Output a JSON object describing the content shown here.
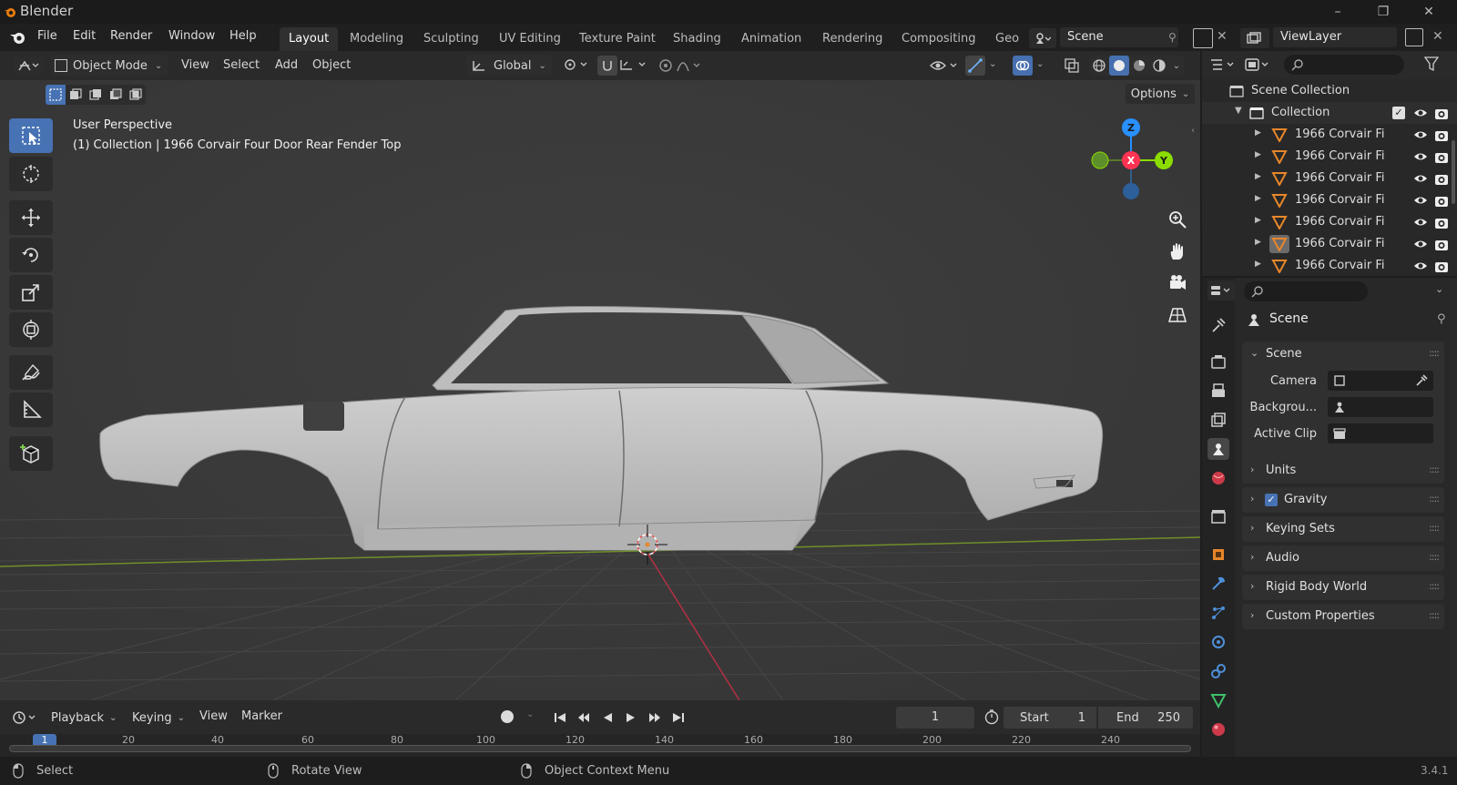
{
  "titlebar": {
    "app_title": "Blender"
  },
  "menu": {
    "file": "File",
    "edit": "Edit",
    "render": "Render",
    "window": "Window",
    "help": "Help"
  },
  "workspaces": [
    "Layout",
    "Modeling",
    "Sculpting",
    "UV Editing",
    "Texture Paint",
    "Shading",
    "Animation",
    "Rendering",
    "Compositing",
    "Geo"
  ],
  "scene_field": "Scene",
  "viewlayer_field": "ViewLayer",
  "viewport": {
    "mode": "Object Mode",
    "menus": {
      "view": "View",
      "select": "Select",
      "add": "Add",
      "object": "Object"
    },
    "transform_orientation": "Global",
    "options_label": "Options",
    "perspective_label": "User Perspective",
    "object_info": "(1) Collection | 1966 Corvair Four Door Rear Fender Top",
    "gizmo": {
      "x": "X",
      "y": "Y",
      "z": "Z"
    }
  },
  "outliner": {
    "scene_collection": "Scene Collection",
    "collection": "Collection",
    "items": [
      "1966 Corvair Fi",
      "1966 Corvair Fi",
      "1966 Corvair Fi",
      "1966 Corvair Fi",
      "1966 Corvair Fi",
      "1966 Corvair Fi",
      "1966 Corvair Fi"
    ]
  },
  "properties": {
    "header": "Scene",
    "scene_panel": "Scene",
    "camera_label": "Camera",
    "background_label": "Backgrou...",
    "active_clip_label": "Active Clip",
    "panels": [
      "Units",
      "Gravity",
      "Keying Sets",
      "Audio",
      "Rigid Body World",
      "Custom Properties"
    ],
    "gravity_checked": true
  },
  "timeline": {
    "playback": "Playback",
    "keying": "Keying",
    "view": "View",
    "marker": "Marker",
    "current_frame": "1",
    "start_label": "Start",
    "start_value": "1",
    "end_label": "End",
    "end_value": "250",
    "ruler_ticks": [
      "1",
      "20",
      "40",
      "60",
      "80",
      "100",
      "120",
      "140",
      "160",
      "180",
      "200",
      "220",
      "240"
    ]
  },
  "statusbar": {
    "select": "Select",
    "rotate_view": "Rotate View",
    "context_menu": "Object Context Menu",
    "version": "3.4.1"
  },
  "colors": {
    "accent": "#4772b3",
    "x_axis": "#ff3352",
    "y_axis": "#8bdc00",
    "z_axis": "#2890ff",
    "object_orange": "#e8862a"
  }
}
